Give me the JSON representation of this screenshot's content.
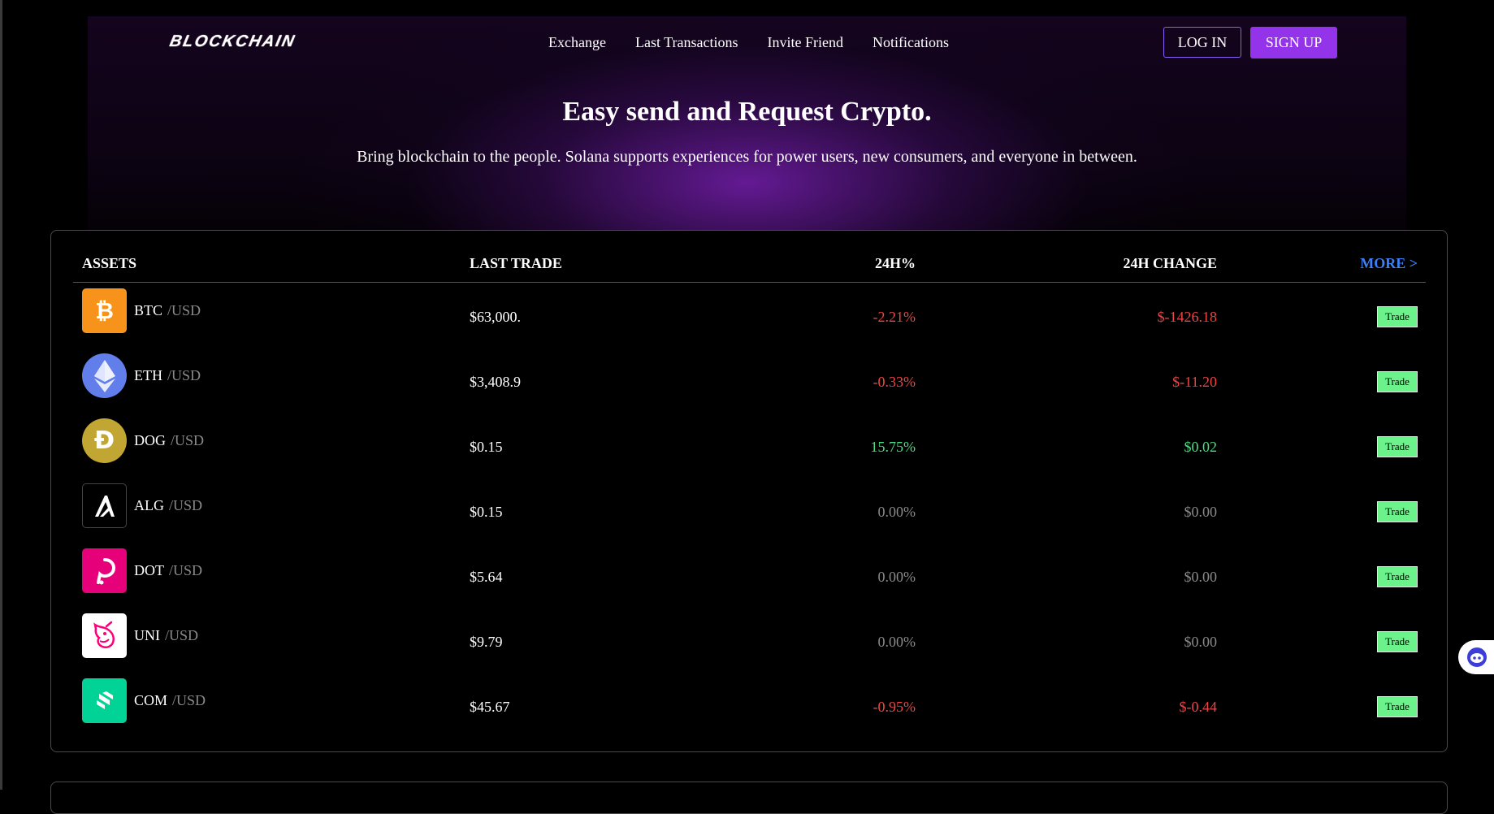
{
  "header": {
    "logo": "BLOCKCHAIN",
    "nav": [
      "Exchange",
      "Last Transactions",
      "Invite Friend",
      "Notifications"
    ],
    "login_label": "LOG IN",
    "signup_label": "SIGN UP"
  },
  "hero": {
    "title": "Easy send and Request Crypto.",
    "subtitle": "Bring blockchain to the people. Solana supports experiences for power users, new consumers, and everyone in between."
  },
  "table": {
    "headers": {
      "assets": "ASSETS",
      "last_trade": "LAST TRADE",
      "pct": "24H%",
      "change": "24H CHANGE",
      "more": "MORE >"
    },
    "rows": [
      {
        "symbol": "BTC",
        "quote": "/USD",
        "last": "$63,000.",
        "pct": "-2.21%",
        "change": "$-1426.18",
        "trend": "negative",
        "icon": "bitcoin-icon",
        "icon_color": "#f7931a",
        "trade": "Trade"
      },
      {
        "symbol": "ETH",
        "quote": "/USD",
        "last": "$3,408.9",
        "pct": "-0.33%",
        "change": "$-11.20",
        "trend": "negative",
        "icon": "ethereum-icon",
        "icon_color": "#627eea",
        "trade": "Trade"
      },
      {
        "symbol": "DOG",
        "quote": "/USD",
        "last": "$0.15",
        "pct": "15.75%",
        "change": "$0.02",
        "trend": "positive",
        "icon": "dogecoin-icon",
        "icon_color": "#c2a633",
        "trade": "Trade"
      },
      {
        "symbol": "ALG",
        "quote": "/USD",
        "last": "$0.15",
        "pct": "0.00%",
        "change": "$0.00",
        "trend": "neutral",
        "icon": "algorand-icon",
        "icon_color": "#000000",
        "trade": "Trade"
      },
      {
        "symbol": "DOT",
        "quote": "/USD",
        "last": "$5.64",
        "pct": "0.00%",
        "change": "$0.00",
        "trend": "neutral",
        "icon": "polkadot-icon",
        "icon_color": "#e6007a",
        "trade": "Trade"
      },
      {
        "symbol": "UNI",
        "quote": "/USD",
        "last": "$9.79",
        "pct": "0.00%",
        "change": "$0.00",
        "trend": "neutral",
        "icon": "uniswap-icon",
        "icon_color": "#ffffff",
        "trade": "Trade"
      },
      {
        "symbol": "COM",
        "quote": "/USD",
        "last": "$45.67",
        "pct": "-0.95%",
        "change": "$-0.44",
        "trend": "negative",
        "icon": "compound-icon",
        "icon_color": "#00d395",
        "trade": "Trade"
      }
    ]
  },
  "colors": {
    "accent": "#9333ea",
    "more_link": "#3b82f6",
    "negative": "#ef4444",
    "positive": "#4ade80",
    "neutral": "#8a8a8a",
    "trade_button": "#6cf28a"
  }
}
